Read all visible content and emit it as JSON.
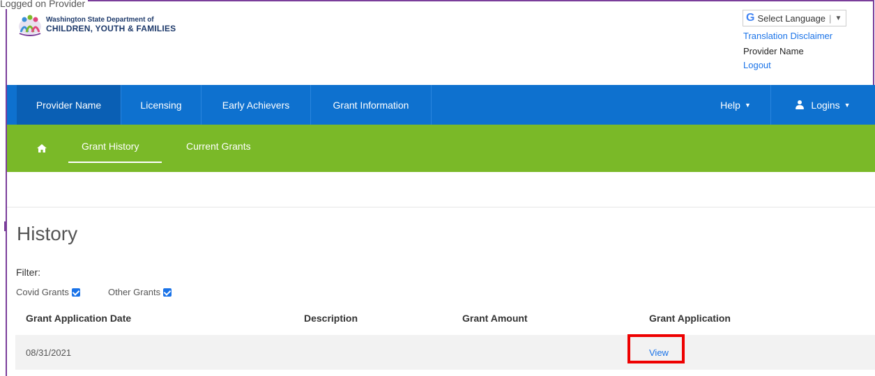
{
  "top_label": "Logged on Provider",
  "header": {
    "logo_line1": "Washington State Department of",
    "logo_line2": "CHILDREN, YOUTH & FAMILIES",
    "language_label": "Select Language",
    "translation_disclaimer": "Translation Disclaimer",
    "provider_name": "Provider Name",
    "logout": "Logout"
  },
  "nav_main": {
    "items": [
      "Provider Name",
      "Licensing",
      "Early Achievers",
      "Grant Information"
    ],
    "help": "Help",
    "logins": "Logins"
  },
  "nav_sub": {
    "items": [
      "Grant History",
      "Current Grants"
    ]
  },
  "main": {
    "title": "History",
    "filter_label": "Filter:",
    "filters": [
      {
        "label": "Covid Grants",
        "checked": true
      },
      {
        "label": "Other Grants",
        "checked": true
      }
    ],
    "table": {
      "headers": [
        "Grant Application Date",
        "Description",
        "Grant Amount",
        "Grant Application"
      ],
      "rows": [
        {
          "date": "08/31/2021",
          "description": "",
          "amount": "",
          "application": "View"
        }
      ]
    }
  },
  "colors": {
    "nav_blue": "#0e71cf",
    "nav_green": "#7ab928",
    "link": "#1a73e8",
    "highlight": "#ee0000"
  }
}
